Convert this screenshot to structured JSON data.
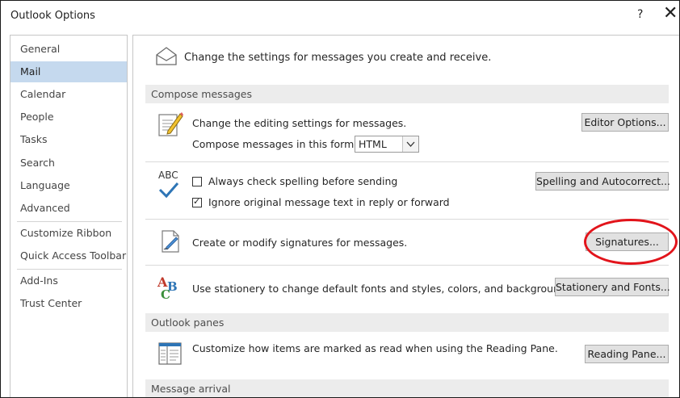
{
  "window": {
    "title": "Outlook Options",
    "help_label": "?",
    "close_label": "✕"
  },
  "sidebar": {
    "items": [
      {
        "label": "General"
      },
      {
        "label": "Mail"
      },
      {
        "label": "Calendar"
      },
      {
        "label": "People"
      },
      {
        "label": "Tasks"
      },
      {
        "label": "Search"
      },
      {
        "label": "Language"
      },
      {
        "label": "Advanced"
      },
      {
        "label": "Customize Ribbon"
      },
      {
        "label": "Quick Access Toolbar"
      },
      {
        "label": "Add-Ins"
      },
      {
        "label": "Trust Center"
      }
    ],
    "selected": "Mail"
  },
  "main": {
    "intro": "Change the settings for messages you create and receive.",
    "compose": {
      "header": "Compose messages",
      "editing_text": "Change the editing settings for messages.",
      "editor_options_button": "Editor Options...",
      "format_label": "Compose messages in this format:",
      "format_value": "HTML",
      "spelling_icon_text": "ABC",
      "spelling_check_label": "Always check spelling before sending",
      "spelling_check_checked": false,
      "ignore_original_label": "Ignore original message text in reply or forward",
      "ignore_original_checked": true,
      "spelling_button": "Spelling and Autocorrect...",
      "signature_text": "Create or modify signatures for messages.",
      "signatures_button": "Signatures...",
      "stationery_text": "Use stationery to change default fonts and styles, colors, and backgrounds.",
      "stationery_button": "Stationery and Fonts..."
    },
    "panes": {
      "header": "Outlook panes",
      "reading_text": "Customize how items are marked as read when using the Reading Pane.",
      "reading_button": "Reading Pane..."
    },
    "arrival": {
      "header": "Message arrival"
    }
  },
  "colors": {
    "accent_selected": "#c5d9ee",
    "annotation_circle": "#e2141b"
  }
}
